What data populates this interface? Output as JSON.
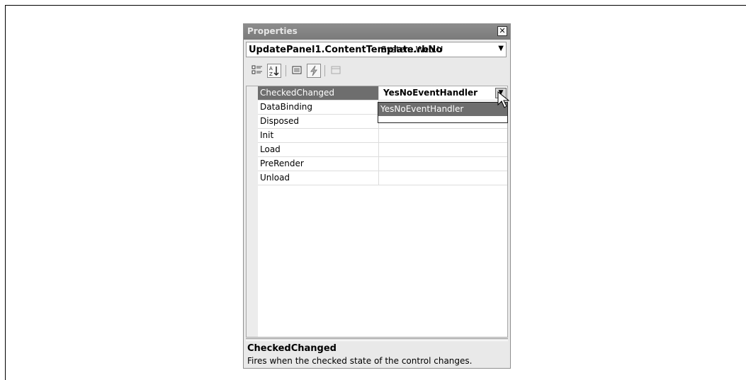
{
  "window": {
    "title": "Properties"
  },
  "object_selector": {
    "name": "UpdatePanel1.ContentTemplate.rbNo",
    "type": "System.Web.U"
  },
  "toolbar": {
    "buttons": [
      {
        "name": "categorized",
        "icon": "categorized-icon"
      },
      {
        "name": "alphabetical",
        "icon": "alphabetical-sort-icon",
        "pressed": true
      },
      {
        "name": "properties",
        "icon": "properties-icon"
      },
      {
        "name": "events",
        "icon": "lightning-icon",
        "pressed": true
      },
      {
        "name": "property-pages",
        "icon": "property-pages-icon",
        "disabled": true
      }
    ]
  },
  "grid": {
    "rows": [
      {
        "name": "CheckedChanged",
        "value": "YesNoEventHandler",
        "selected": true
      },
      {
        "name": "DataBinding",
        "value": ""
      },
      {
        "name": "Disposed",
        "value": ""
      },
      {
        "name": "Init",
        "value": ""
      },
      {
        "name": "Load",
        "value": ""
      },
      {
        "name": "PreRender",
        "value": ""
      },
      {
        "name": "Unload",
        "value": ""
      }
    ]
  },
  "dropdown": {
    "options": [
      "YesNoEventHandler"
    ]
  },
  "description": {
    "title": "CheckedChanged",
    "text": "Fires when the checked state of the control changes."
  }
}
